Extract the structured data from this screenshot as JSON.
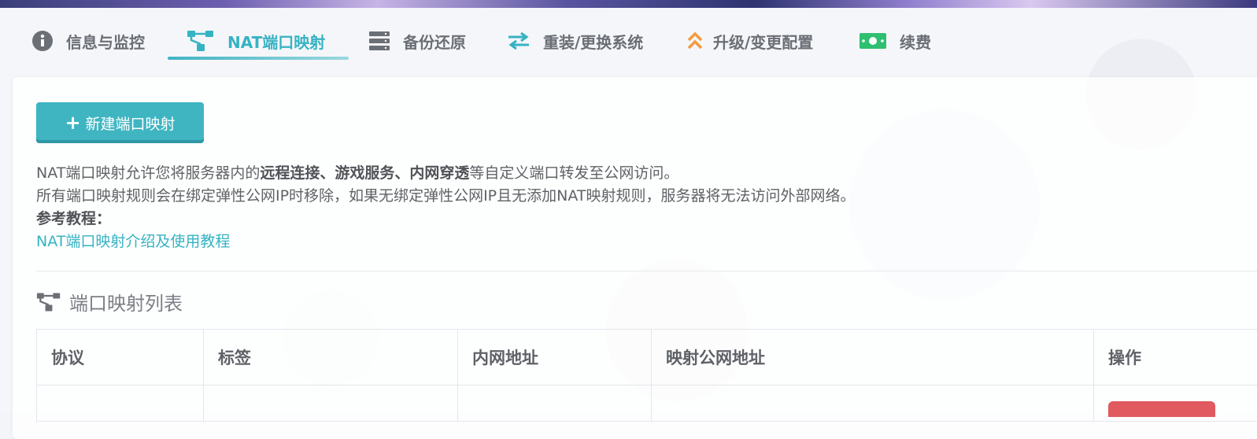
{
  "tabs": [
    {
      "label": "信息与监控",
      "icon": "info-icon",
      "active": false
    },
    {
      "label": "NAT端口映射",
      "icon": "nat-mapping-icon",
      "active": true
    },
    {
      "label": "备份还原",
      "icon": "server-icon",
      "active": false
    },
    {
      "label": "重装/更换系统",
      "icon": "exchange-icon",
      "active": false
    },
    {
      "label": "升级/变更配置",
      "icon": "double-chevron-up-icon",
      "active": false
    },
    {
      "label": "续费",
      "icon": "money-icon",
      "active": false
    }
  ],
  "toolbar": {
    "new_mapping_label": "新建端口映射"
  },
  "description": {
    "line1_prefix": "NAT端口映射允许您将服务器内的",
    "line1_bold": "远程连接、游戏服务、内网穿透",
    "line1_suffix": "等自定义端口转发至公网访问。",
    "line2": "所有端口映射规则会在绑定弹性公网IP时移除，如果无绑定弹性公网IP且无添加NAT映射规则，服务器将无法访问外部网络。",
    "reference_label": "参考教程：",
    "tutorial_link": "NAT端口映射介绍及使用教程"
  },
  "list": {
    "title": "端口映射列表",
    "columns": [
      "协议",
      "标签",
      "内网地址",
      "映射公网地址",
      "操作"
    ]
  },
  "colors": {
    "accent": "#3fb5c2",
    "danger": "#e05a5f",
    "upgrade_icon": "#f59a3c",
    "renew_icon": "#2fbf71"
  }
}
